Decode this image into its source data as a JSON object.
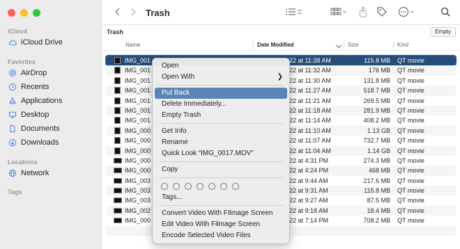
{
  "window": {
    "title": "Trash"
  },
  "sidebar": {
    "sections": [
      {
        "label": "iCloud",
        "items": [
          {
            "label": "iCloud Drive",
            "icon": "cloud-icon"
          }
        ]
      },
      {
        "label": "Favorites",
        "items": [
          {
            "label": "AirDrop",
            "icon": "airdrop-icon"
          },
          {
            "label": "Recents",
            "icon": "clock-icon"
          },
          {
            "label": "Applications",
            "icon": "applications-icon"
          },
          {
            "label": "Desktop",
            "icon": "desktop-icon"
          },
          {
            "label": "Documents",
            "icon": "document-icon"
          },
          {
            "label": "Downloads",
            "icon": "download-icon"
          }
        ]
      },
      {
        "label": "Locations",
        "items": [
          {
            "label": "Network",
            "icon": "globe-icon"
          }
        ]
      },
      {
        "label": "Tags",
        "items": []
      }
    ]
  },
  "pathbar": {
    "label": "Trash",
    "empty_button": "Empty"
  },
  "columns": {
    "name": "Name",
    "date": "Date Modified",
    "size": "Size",
    "kind": "Kind"
  },
  "files": [
    {
      "name": "IMG_001",
      "date": "22 at 11:38 AM",
      "size": "115.8 MB",
      "kind": "QT movie",
      "selected": true
    },
    {
      "name": "IMG_001",
      "date": "22 at 11:32 AM",
      "size": "176 MB",
      "kind": "QT movie"
    },
    {
      "name": "IMG_001",
      "date": "22 at 11:30 AM",
      "size": "131.8 MB",
      "kind": "QT movie"
    },
    {
      "name": "IMG_001",
      "date": "22 at 11:27 AM",
      "size": "518.7 MB",
      "kind": "QT movie"
    },
    {
      "name": "IMG_001",
      "date": "22 at 11:21 AM",
      "size": "269.5 MB",
      "kind": "QT movie"
    },
    {
      "name": "IMG_001",
      "date": "22 at 11:18 AM",
      "size": "281.9 MB",
      "kind": "QT movie"
    },
    {
      "name": "IMG_001",
      "date": "22 at 11:14 AM",
      "size": "408.2 MB",
      "kind": "QT movie"
    },
    {
      "name": "IMG_000",
      "date": "22 at 11:10 AM",
      "size": "1.13 GB",
      "kind": "QT movie"
    },
    {
      "name": "IMG_000",
      "date": "22 at 11:07 AM",
      "size": "732.7 MB",
      "kind": "QT movie"
    },
    {
      "name": "IMG_000",
      "date": "22 at 11:04 AM",
      "size": "1.14 GB",
      "kind": "QT movie"
    },
    {
      "name": "IMG_000",
      "date": "22 at 4:31 PM",
      "size": "274.3 MB",
      "kind": "QT movie"
    },
    {
      "name": "IMG_000",
      "date": "22 at 4:24 PM",
      "size": "468 MB",
      "kind": "QT movie"
    },
    {
      "name": "IMG_003",
      "date": "22 at 9:44 AM",
      "size": "217.6 MB",
      "kind": "QT movie"
    },
    {
      "name": "IMG_003",
      "date": "22 at 9:31 AM",
      "size": "115.8 MB",
      "kind": "QT movie"
    },
    {
      "name": "IMG_003",
      "date": "22 at 9:27 AM",
      "size": "87.5 MB",
      "kind": "QT movie"
    },
    {
      "name": "IMG_002",
      "date": "22 at 9:18 AM",
      "size": "18.4 MB",
      "kind": "QT movie"
    },
    {
      "name": "IMG_000",
      "date": "22 at 7:14 PM",
      "size": "708.2 MB",
      "kind": "QT movie"
    }
  ],
  "context_menu": {
    "items": [
      {
        "label": "Open"
      },
      {
        "label": "Open With",
        "submenu": true
      },
      {
        "separator": true
      },
      {
        "label": "Put Back",
        "highlighted": true
      },
      {
        "label": "Delete Immediately..."
      },
      {
        "label": "Empty Trash"
      },
      {
        "separator": true
      },
      {
        "label": "Get Info"
      },
      {
        "label": "Rename"
      },
      {
        "label": "Quick Look “IMG_0017.MOV”"
      },
      {
        "separator": true
      },
      {
        "label": "Copy"
      },
      {
        "separator": true
      },
      {
        "tags": true
      },
      {
        "label": "Tags..."
      },
      {
        "separator": true
      },
      {
        "label": "Convert Video With FIlmage Screen"
      },
      {
        "label": "Edit Video With Filmage Screen"
      },
      {
        "label": "Encode Selected Video Files"
      }
    ]
  },
  "colors": {
    "selection": "#254d7a",
    "menu_highlight": "#5a86b7",
    "accent_icon": "#3b82f6"
  }
}
